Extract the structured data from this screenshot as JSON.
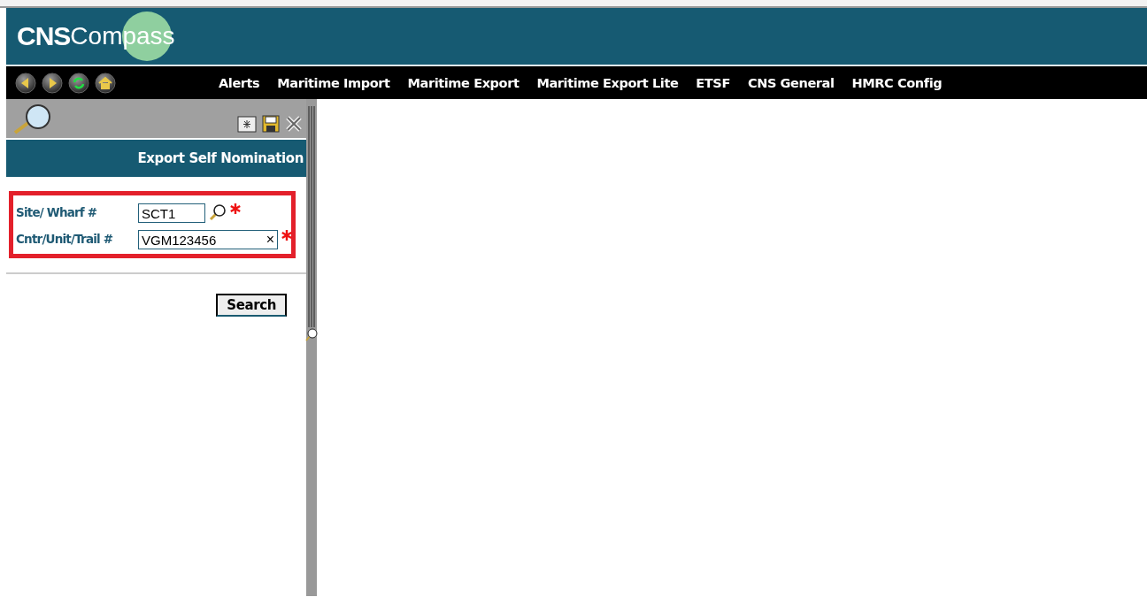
{
  "header": {
    "logo": {
      "strong": "CNS",
      "light": "Compass"
    }
  },
  "nav": {
    "menu": [
      "Alerts",
      "Maritime Import",
      "Maritime Export",
      "Maritime Export Lite",
      "ETSF",
      "CNS General",
      "HMRC Config"
    ]
  },
  "panel": {
    "title": "Export Self Nomination",
    "fields": [
      {
        "label": "Site/ Wharf #",
        "value": "SCT1",
        "kind": "lookup",
        "required": true
      },
      {
        "label": "Cntr/Unit/Trail #",
        "value": "VGM123456",
        "kind": "clearable",
        "clear_symbol": "×",
        "required": true
      }
    ],
    "search_button": "Search"
  }
}
